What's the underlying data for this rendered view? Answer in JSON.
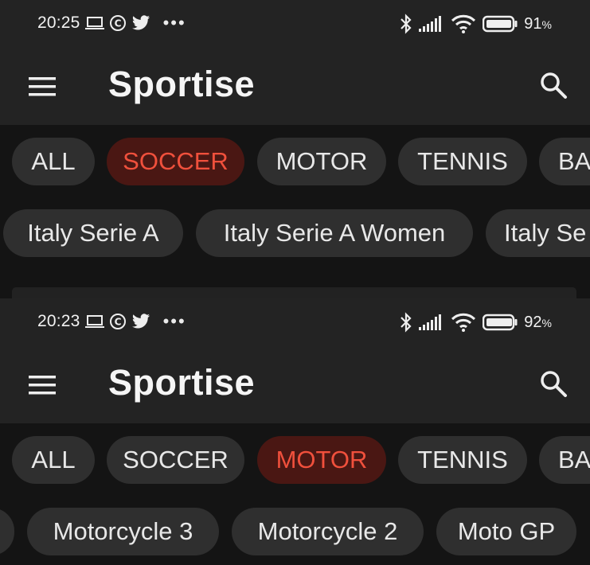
{
  "screens": [
    {
      "time": "20:25",
      "battery_value": "91",
      "battery_unit": "%",
      "app_title": "Sportise",
      "categories": [
        "ALL",
        "SOCCER",
        "MOTOR",
        "TENNIS",
        "BA"
      ],
      "selected_category": "SOCCER",
      "subcategories": [
        "Italy Serie A",
        "Italy Serie A Women",
        "Italy Se"
      ]
    },
    {
      "time": "20:23",
      "battery_value": "92",
      "battery_unit": "%",
      "app_title": "Sportise",
      "categories": [
        "ALL",
        "SOCCER",
        "MOTOR",
        "TENNIS",
        "BA"
      ],
      "selected_category": "MOTOR",
      "subcategories": [
        "Motorcycle 3",
        "Motorcycle 2",
        "Moto GP"
      ]
    }
  ],
  "colors": {
    "background": "#141414",
    "bar": "#232323",
    "chip": "#2f2f2f",
    "chip_active_bg": "#4a1713",
    "chip_active_text": "#f0503c"
  },
  "icons": {
    "status_left": [
      "laptop-icon",
      "copyright-c-icon",
      "twitter-icon",
      "more-dots-icon"
    ],
    "status_right": [
      "bluetooth-icon",
      "signal-icon",
      "wifi-icon",
      "battery-icon"
    ],
    "menu": "hamburger-menu-icon",
    "search": "search-icon"
  }
}
